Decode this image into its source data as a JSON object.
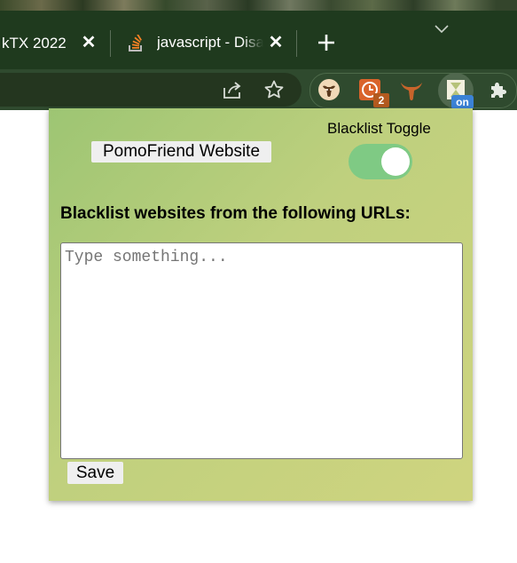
{
  "browser": {
    "tabs": [
      {
        "title": "kTX 2022",
        "close": "✕"
      },
      {
        "title": "javascript - Disable",
        "close": "✕"
      }
    ],
    "new_tab_symbol": "+",
    "toolbar_icons": [
      "share-icon",
      "star-icon"
    ],
    "extensions": [
      {
        "name": "cow-extension-icon"
      },
      {
        "name": "timer-extension-icon",
        "badge": "2"
      },
      {
        "name": "longhorn-extension-icon"
      },
      {
        "name": "pomofriend-extension-icon",
        "badge": "on"
      },
      {
        "name": "puzzle-icon"
      }
    ],
    "colors": {
      "tabstrip": "#1f3a1e",
      "toolbar": "#2f4a2e",
      "badge_count": "#b35a1f",
      "badge_on": "#3b82d6"
    }
  },
  "popup": {
    "website_button": "PomoFriend Website",
    "toggle_label": "Blacklist Toggle",
    "toggle_on": true,
    "heading": "Blacklist websites from the following URLs:",
    "textarea_placeholder": "Type something...",
    "textarea_value": "",
    "save_button": "Save",
    "colors": {
      "background_start": "#9dc573",
      "background_end": "#cfd47f",
      "toggle": "#7fca84"
    }
  }
}
